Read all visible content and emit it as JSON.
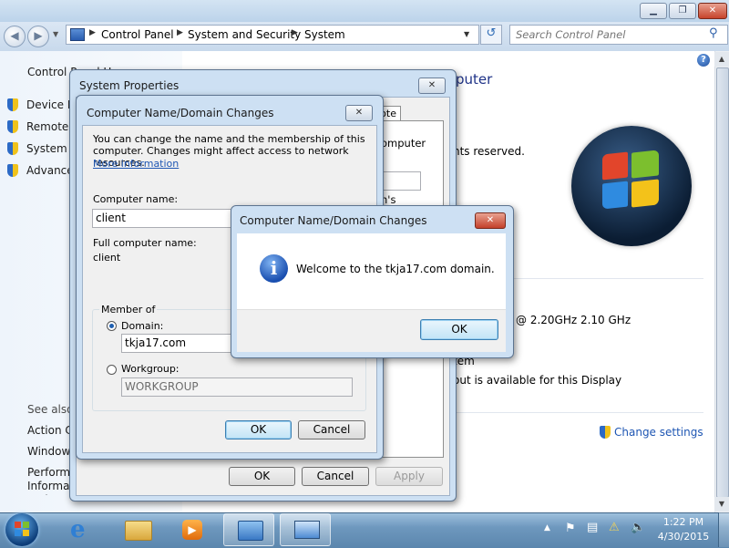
{
  "window": {
    "minimize_glyph": "▁",
    "maximize_glyph": "❐",
    "close_glyph": "✕"
  },
  "nav": {
    "back_icon": "arrow-left-icon",
    "forward_icon": "arrow-right-icon",
    "breadcrumbs": [
      "Control Panel",
      "System and Security",
      "System"
    ],
    "search_placeholder": "Search Control Panel"
  },
  "left_pane": {
    "home_link": "Control Panel Home",
    "tasks": [
      {
        "label": "Device Manager",
        "icon": "shield-icon"
      },
      {
        "label": "Remote settings",
        "icon": "shield-icon"
      },
      {
        "label": "System protection",
        "icon": "shield-icon"
      },
      {
        "label": "Advanced system settings",
        "icon": "shield-icon"
      }
    ],
    "see_also_heading": "See also",
    "see_also": [
      "Action Center",
      "Windows Update",
      "Performance Information and Tools"
    ]
  },
  "content": {
    "title_fragment": "puter",
    "copyright_fragment": "nts reserved.",
    "cpu_fragment": "@ 2.20GHz   2.10 GHz",
    "system_type_fragment": "tem",
    "pen_fragment": "out is available for this Display",
    "change_settings": "Change settings"
  },
  "system_properties": {
    "title": "System Properties",
    "close_glyph": "✕",
    "tab_fragment": "note",
    "fragment_1": "omputer",
    "fragment_2": "n's",
    "buttons": {
      "ok": "OK",
      "cancel": "Cancel",
      "apply": "Apply"
    }
  },
  "name_changes": {
    "title": "Computer Name/Domain Changes",
    "close_glyph": "✕",
    "description": "You can change the name and the membership of this computer. Changes might affect access to network resources.",
    "more_info": "More information",
    "computer_name_label": "Computer name:",
    "computer_name_value": "client",
    "full_name_label": "Full computer name:",
    "full_name_value": "client",
    "member_of_label": "Member of",
    "domain_label": "Domain:",
    "domain_value": "tkja17.com",
    "workgroup_label": "Workgroup:",
    "workgroup_value": "WORKGROUP",
    "buttons": {
      "ok": "OK",
      "cancel": "Cancel"
    }
  },
  "welcome_dialog": {
    "title": "Computer Name/Domain Changes",
    "close_glyph": "✕",
    "message": "Welcome to the tkja17.com domain.",
    "icon": "info-icon",
    "ok": "OK"
  },
  "taskbar": {
    "apps": [
      "start-orb",
      "internet-explorer",
      "windows-explorer",
      "media-player",
      "control-panel",
      "remote-desktop"
    ],
    "time": "1:22 PM",
    "date": "4/30/2015"
  }
}
